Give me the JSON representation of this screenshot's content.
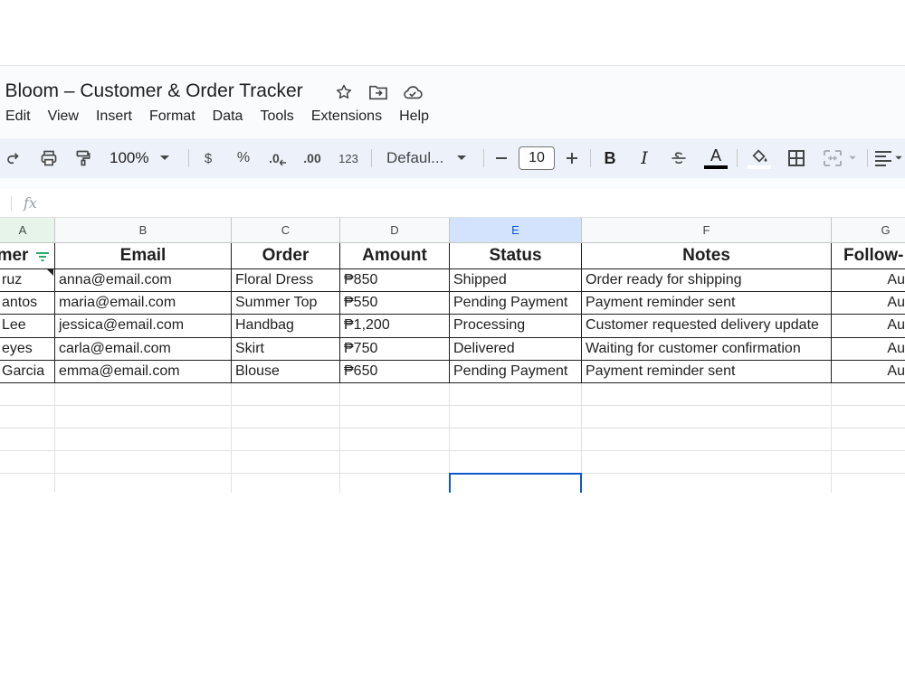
{
  "document": {
    "title": "a Bloom – Customer & Order Tracker"
  },
  "menu": [
    "Edit",
    "View",
    "Insert",
    "Format",
    "Data",
    "Tools",
    "Extensions",
    "Help"
  ],
  "toolbar": {
    "zoom": "100%",
    "currency": "$",
    "percent": "%",
    "decrease_decimal": ".0",
    "increase_decimal": ".00",
    "number_format": "123",
    "font": "Defaul...",
    "font_size": "10",
    "bold": "B",
    "italic": "I",
    "text_color_letter": "A"
  },
  "formula_bar": {
    "fx": "fx"
  },
  "columns": [
    "A",
    "B",
    "C",
    "D",
    "E",
    "F",
    "G"
  ],
  "table": {
    "headers": [
      "mer",
      "Email",
      "Order",
      "Amount",
      "Status",
      "Notes",
      "Follow-"
    ],
    "rows": [
      [
        "ruz",
        "anna@email.com",
        "Floral Dress",
        "₱850",
        "Shipped",
        "Order ready for shipping",
        "Au"
      ],
      [
        "antos",
        "maria@email.com",
        "Summer Top",
        "₱550",
        "Pending Payment",
        "Payment reminder sent",
        "Au"
      ],
      [
        " Lee",
        "jessica@email.com",
        "Handbag",
        "₱1,200",
        "Processing",
        "Customer requested delivery update",
        "Au"
      ],
      [
        "eyes",
        "carla@email.com",
        "Skirt",
        "₱750",
        "Delivered",
        "Waiting for customer confirmation",
        "Au"
      ],
      [
        "Garcia",
        "emma@email.com",
        "Blouse",
        "₱650",
        "Pending Payment",
        "Payment reminder sent",
        "Au"
      ]
    ]
  },
  "colors": {
    "accent": "#0b57d0",
    "toolbar_bg": "#edf2fa",
    "header_selected": "#d3e3fd"
  },
  "icons": [
    "star-icon",
    "move-to-folder-icon",
    "cloud-saved-icon",
    "history-icon",
    "comment-icon",
    "redo-icon",
    "print-icon",
    "paint-format-icon",
    "chevron-down-icon",
    "minus-icon",
    "plus-icon",
    "strikethrough-icon",
    "text-color-icon",
    "fill-color-icon",
    "borders-icon",
    "merge-cells-icon",
    "align-icon",
    "filter-icon"
  ]
}
